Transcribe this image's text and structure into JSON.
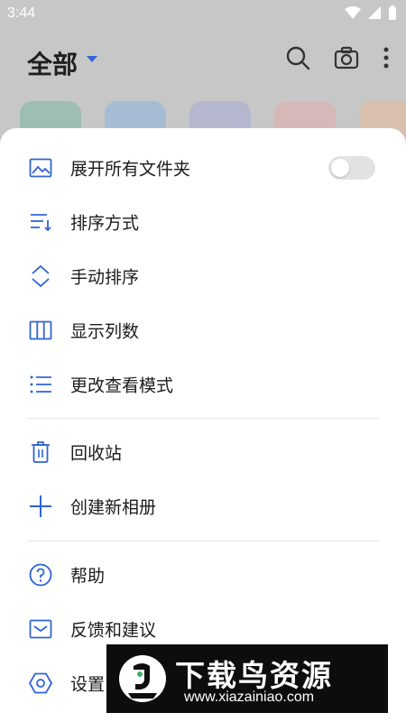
{
  "status_bar": {
    "time": "3:44"
  },
  "header": {
    "title": "全部"
  },
  "menu": {
    "items": [
      {
        "label": "展开所有文件夹"
      },
      {
        "label": "排序方式"
      },
      {
        "label": "手动排序"
      },
      {
        "label": "显示列数"
      },
      {
        "label": "更改查看模式"
      },
      {
        "label": "回收站"
      },
      {
        "label": "创建新相册"
      },
      {
        "label": "帮助"
      },
      {
        "label": "反馈和建议"
      },
      {
        "label": "设置"
      }
    ],
    "expand_all_toggle": "off"
  },
  "watermark": {
    "title": "下载鸟资源",
    "url": "www.xiazainiao.com"
  },
  "colors": {
    "accent": "#2f64d6",
    "scrim": "#c7c7c7",
    "sheet": "#ffffff"
  },
  "icons": [
    "search-icon",
    "camera-icon",
    "more-vert-icon",
    "image-icon",
    "sort-icon",
    "drag-sort-icon",
    "columns-icon",
    "list-view-icon",
    "trash-icon",
    "plus-icon",
    "help-icon",
    "feedback-icon",
    "settings-icon"
  ]
}
